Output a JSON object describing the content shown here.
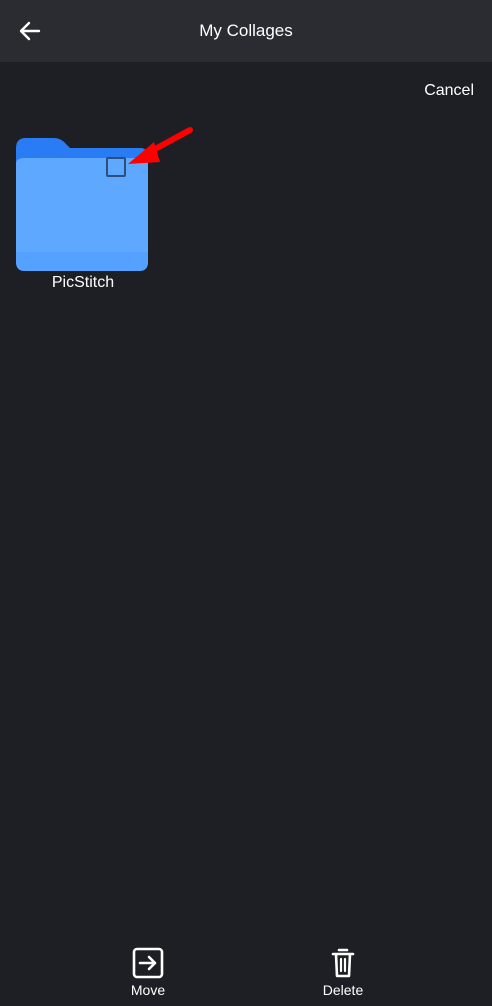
{
  "header": {
    "title": "My Collages",
    "back_icon": "arrow-left-icon"
  },
  "toolbar": {
    "cancel_label": "Cancel"
  },
  "folders": [
    {
      "name": "PicStitch",
      "selected": false
    }
  ],
  "bottom_bar": {
    "move_label": "Move",
    "move_icon": "move-icon",
    "delete_label": "Delete",
    "delete_icon": "trash-icon"
  },
  "colors": {
    "background": "#1e1f24",
    "header": "#2b2c31",
    "folder_front": "#5fa8ff",
    "folder_back": "#2a7cf5",
    "annotation_arrow": "#ff0000"
  }
}
